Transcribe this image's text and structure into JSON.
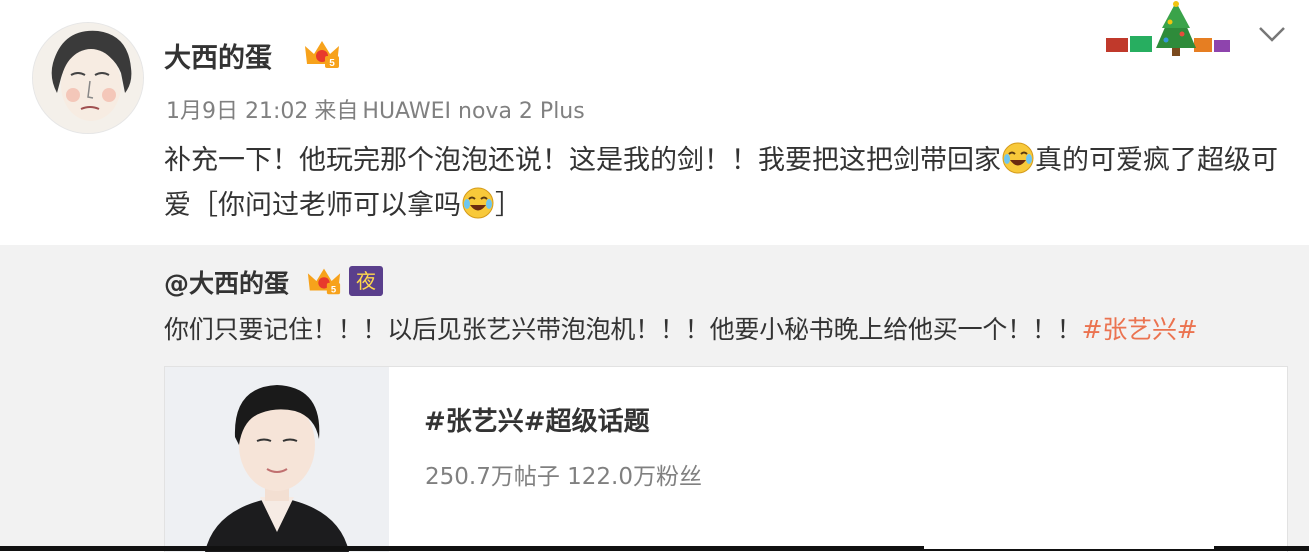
{
  "post": {
    "username": "大西的蛋",
    "timestamp": "1月9日 21:02",
    "source_prefix": "来自",
    "source": "HUAWEI nova 2 Plus",
    "content_part1": "补充一下！他玩完那个泡泡还说！这是我的剑！！我要把这把剑带回家",
    "content_part2": "真的可爱疯了超级可爱［你问过老师可以拿吗",
    "content_part3": "］"
  },
  "repost": {
    "username": "@大西的蛋",
    "night_badge": "夜",
    "text": "你们只要记住！！！以后见张艺兴带泡泡机！！！他要小秘书晚上给他买一个！！！",
    "hashtag": "#张艺兴#"
  },
  "card": {
    "title": "#张艺兴#超级话题",
    "stats": "250.7万帖子 122.0万粉丝"
  },
  "icons": {
    "vip": "vip-crown-icon",
    "emoji": "laugh-cry-emoji",
    "menu": "chevron-down-icon"
  },
  "colors": {
    "hashtag": "#eb7350",
    "repost_bg": "#f2f2f2",
    "meta": "#808080"
  }
}
